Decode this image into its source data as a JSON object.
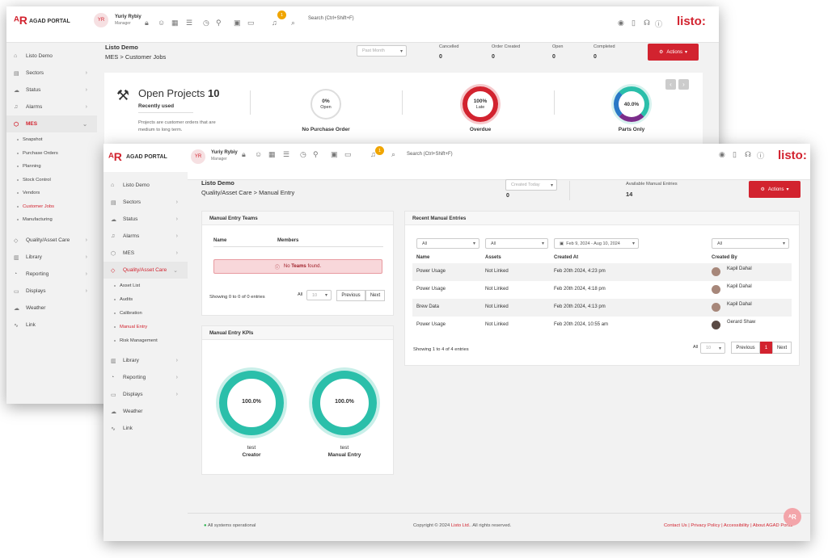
{
  "back": {
    "brand": "AGAD PORTAL",
    "user": {
      "initials": "YR",
      "name": "Yuriy Rybiy",
      "role": "Manager"
    },
    "notification_count": "1",
    "search_placeholder": "Search (Ctrl+Shift+F)",
    "logo": "listo:",
    "sidebar": {
      "items": [
        {
          "label": "Listo Demo",
          "icon": "home-icon"
        },
        {
          "label": "Sectors",
          "icon": "sectors-icon"
        },
        {
          "label": "Status",
          "icon": "status-icon"
        },
        {
          "label": "Alarms",
          "icon": "bell-icon"
        },
        {
          "label": "MES",
          "icon": "cube-icon"
        }
      ],
      "mes_sub": [
        "Snapshot",
        "Purchase Orders",
        "Planning",
        "Stock Control",
        "Vendors",
        "Customer Jobs",
        "Manufacturing"
      ],
      "items_after": [
        {
          "label": "Quality/Asset Care"
        },
        {
          "label": "Library"
        },
        {
          "label": "Reporting"
        },
        {
          "label": "Displays"
        },
        {
          "label": "Weather"
        },
        {
          "label": "Link"
        }
      ]
    },
    "page_title": "Listo Demo",
    "breadcrumb": [
      "MES",
      "Customer Jobs"
    ],
    "period": "Past Month",
    "stats": [
      {
        "label": "Cancelled",
        "value": "0"
      },
      {
        "label": "Order Created",
        "value": "0"
      },
      {
        "label": "Open",
        "value": "0"
      },
      {
        "label": "Completed",
        "value": "0"
      }
    ],
    "actions_label": "Actions",
    "projects": {
      "title": "Open Projects",
      "count": "10",
      "subtitle": "Recently used",
      "description": "Projects are customer orders that are medium to long term.",
      "kpis": [
        {
          "value": "0%",
          "sub": "Open",
          "label": "No Purchase Order"
        },
        {
          "value": "100%",
          "sub": "Late",
          "label": "Overdue"
        },
        {
          "value": "40.0%",
          "sub": "",
          "label": "Parts Only"
        }
      ]
    }
  },
  "front": {
    "brand": "AGAD PORTAL",
    "user": {
      "initials": "YR",
      "name": "Yuriy Rybiy",
      "role": "Manager"
    },
    "notification_count": "1",
    "search_placeholder": "Search (Ctrl+Shift+F)",
    "logo": "listo:",
    "sidebar": {
      "items": [
        {
          "label": "Listo Demo"
        },
        {
          "label": "Sectors"
        },
        {
          "label": "Status"
        },
        {
          "label": "Alarms"
        },
        {
          "label": "MES"
        },
        {
          "label": "Quality/Asset Care"
        }
      ],
      "qa_sub": [
        "Asset List",
        "Audits",
        "Calibration",
        "Manual Entry",
        "Risk Management"
      ],
      "items_after": [
        {
          "label": "Library"
        },
        {
          "label": "Reporting"
        },
        {
          "label": "Displays"
        },
        {
          "label": "Weather"
        },
        {
          "label": "Link"
        }
      ]
    },
    "page_title": "Listo Demo",
    "breadcrumb": [
      "Quality/Asset Care",
      "Manual Entry"
    ],
    "period": "Created Today",
    "created_value": "0",
    "available": {
      "label": "Available Manual Entries",
      "value": "14"
    },
    "actions_label": "Actions",
    "teams": {
      "title": "Manual Entry Teams",
      "columns": [
        "Name",
        "Members"
      ],
      "empty_prefix": "No",
      "empty_bold": "Teams",
      "empty_suffix": "found.",
      "info": "Showing 0 to 0 of 0 entries",
      "all_label": "All",
      "page_size": "10",
      "prev": "Previous",
      "next": "Next"
    },
    "kpis": {
      "title": "Manual Entry KPIs",
      "items": [
        {
          "value": "100.0%",
          "line1": "test",
          "line2": "Creator"
        },
        {
          "value": "100.0%",
          "line1": "test",
          "line2": "Manual Entry"
        }
      ]
    },
    "recent": {
      "title": "Recent Manual Entries",
      "filters": {
        "name": "All",
        "assets": "All",
        "date_range": "Feb 9, 2024 - Aug 10, 2024",
        "created_by": "All"
      },
      "columns": [
        "Name",
        "Assets",
        "Created At",
        "Created By"
      ],
      "rows": [
        {
          "name": "Power Usage",
          "assets": "Not Linked",
          "created_at": "Feb 20th 2024, 4:23 pm",
          "created_by": "Kapil Dahal"
        },
        {
          "name": "Power Usage",
          "assets": "Not Linked",
          "created_at": "Feb 20th 2024, 4:18 pm",
          "created_by": "Kapil Dahal"
        },
        {
          "name": "Brew Data",
          "assets": "Not Linked",
          "created_at": "Feb 20th 2024, 4:13 pm",
          "created_by": "Kapil Dahal"
        },
        {
          "name": "Power Usage",
          "assets": "Not Linked",
          "created_at": "Feb 20th 2024, 10:55 am",
          "created_by": "Gerard Shaw"
        }
      ],
      "info": "Showing 1 to 4 of 4 entries",
      "all_label": "All",
      "page_size": "10",
      "prev": "Previous",
      "page": "1",
      "next": "Next"
    },
    "footer": {
      "status": "All systems operational",
      "copyright_prefix": "Copyright © 2024",
      "company": "Listo Ltd.",
      "copyright_suffix": "All rights reserved.",
      "links": "Contact Us | Privacy Policy | Accessibility | About AGAD Portal"
    }
  },
  "colors": {
    "brand_red": "#d2232f",
    "teal": "#2bbfaa",
    "sidebar_bg": "#f2f2f2"
  }
}
